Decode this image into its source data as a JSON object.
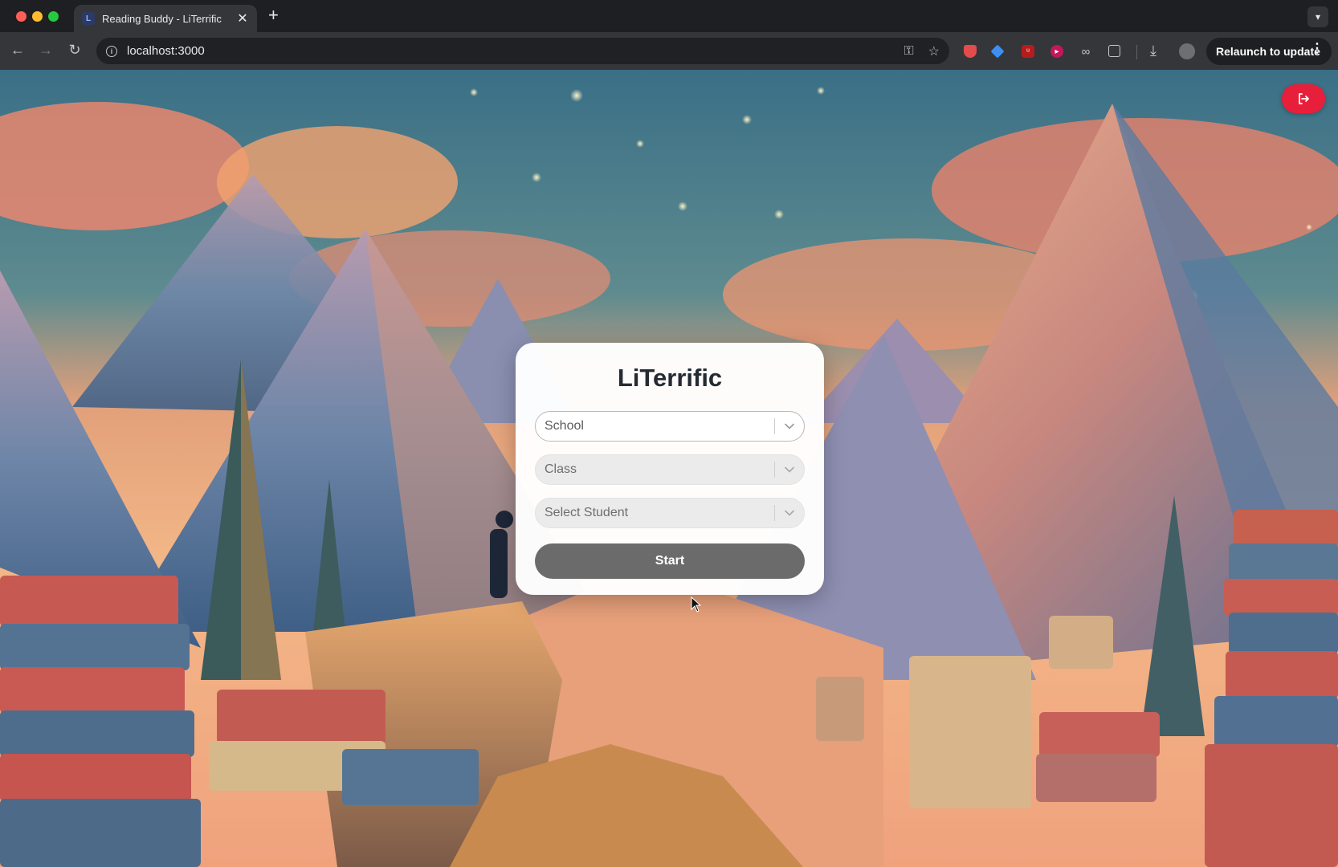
{
  "browser": {
    "tab_title": "Reading Buddy - LiTerrific",
    "tab_close_glyph": "✕",
    "new_tab_glyph": "+",
    "tab_list_glyph": "⌄",
    "url": "localhost:3000",
    "relaunch_label": "Relaunch to update",
    "menu_glyph": "⋮"
  },
  "login_card": {
    "title": "LiTerrific",
    "school_placeholder": "School",
    "class_placeholder": "Class",
    "student_placeholder": "Select Student",
    "start_label": "Start"
  },
  "colors": {
    "logout_button": "#e81f3b",
    "start_button": "#6b6b6b",
    "title_text": "#262b33"
  },
  "icons": [
    "back-icon",
    "forward-icon",
    "reload-icon",
    "info-icon",
    "password-key-icon",
    "bookmark-star-icon",
    "download-icon",
    "logout-icon",
    "chevron-down-icon"
  ]
}
